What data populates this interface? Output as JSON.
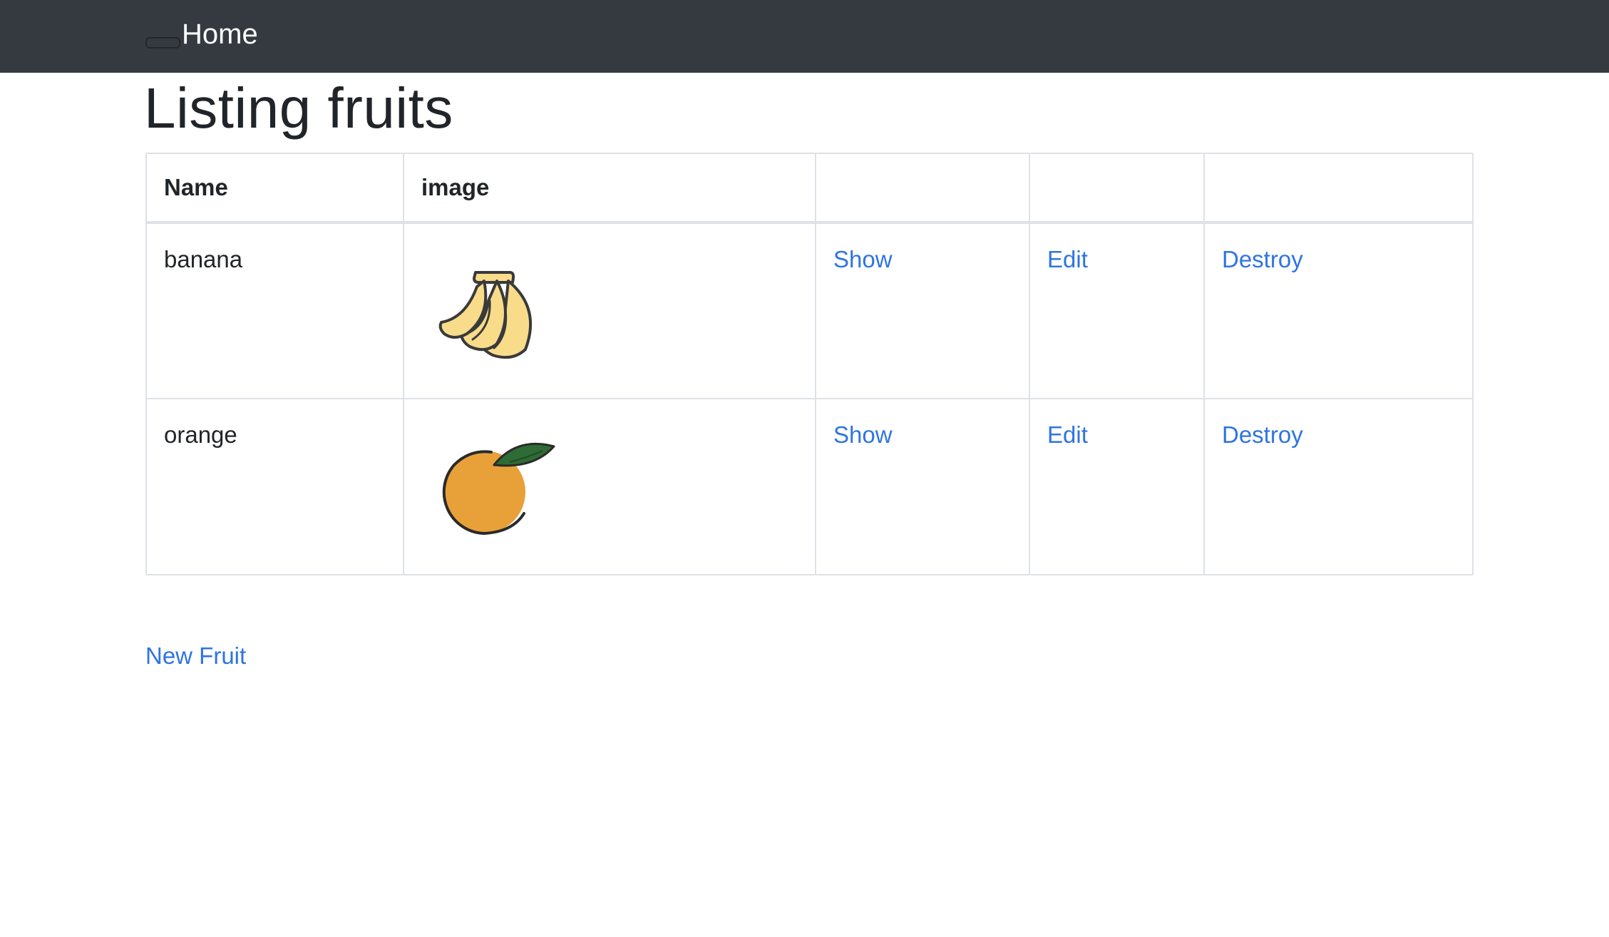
{
  "navbar": {
    "home_label": "Home"
  },
  "page": {
    "title": "Listing fruits"
  },
  "table": {
    "headers": [
      "Name",
      "image",
      "",
      "",
      ""
    ],
    "rows": [
      {
        "name": "banana",
        "image_icon": "banana-icon",
        "show_label": "Show",
        "edit_label": "Edit",
        "destroy_label": "Destroy"
      },
      {
        "name": "orange",
        "image_icon": "orange-icon",
        "show_label": "Show",
        "edit_label": "Edit",
        "destroy_label": "Destroy"
      }
    ]
  },
  "actions": {
    "new_fruit_label": "New Fruit"
  },
  "colors": {
    "navbar_bg": "#343a40",
    "link": "#2f74e0",
    "border": "#dee2e6",
    "banana_fill": "#f9dc8a",
    "orange_fill": "#e8a038",
    "leaf": "#2f6b35"
  }
}
